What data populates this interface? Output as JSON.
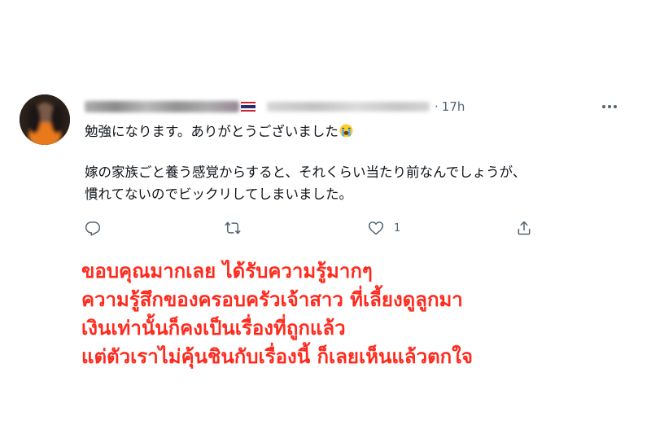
{
  "tweet": {
    "author": {
      "display_name": "",
      "handle": "",
      "flag_icon": "thailand-flag-icon"
    },
    "separator": "·",
    "time": "17h",
    "more_icon": "more-horizontal-icon",
    "text": {
      "line1": "勉強になります。ありがとうございました",
      "line1_emoji": "loudly-crying-face-emoji",
      "line2": "嫁の家族ごと養う感覚からすると、それくらい当たり前なんでしょうが、",
      "line3": "慣れてないのでビックリしてしまいました。"
    },
    "actions": {
      "reply_icon": "reply-icon",
      "retweet_icon": "retweet-icon",
      "like_icon": "heart-icon",
      "like_count": "1",
      "share_icon": "share-icon"
    }
  },
  "caption": {
    "color": "#ff2a1e",
    "lines": [
      "ขอบคุณมากเลย ได้รับความรู้มากๆ",
      "ความรู้สึกของครอบครัวเจ้าสาว ที่เลี้ยงดูลูกมา",
      "เงินเท่านั้นก็คงเป็นเรื่องที่ถูกแล้ว",
      "แต่ตัวเราไม่คุ้นชินกับเรื่องนี้ ก็เลยเห็นแล้วตกใจ"
    ]
  }
}
